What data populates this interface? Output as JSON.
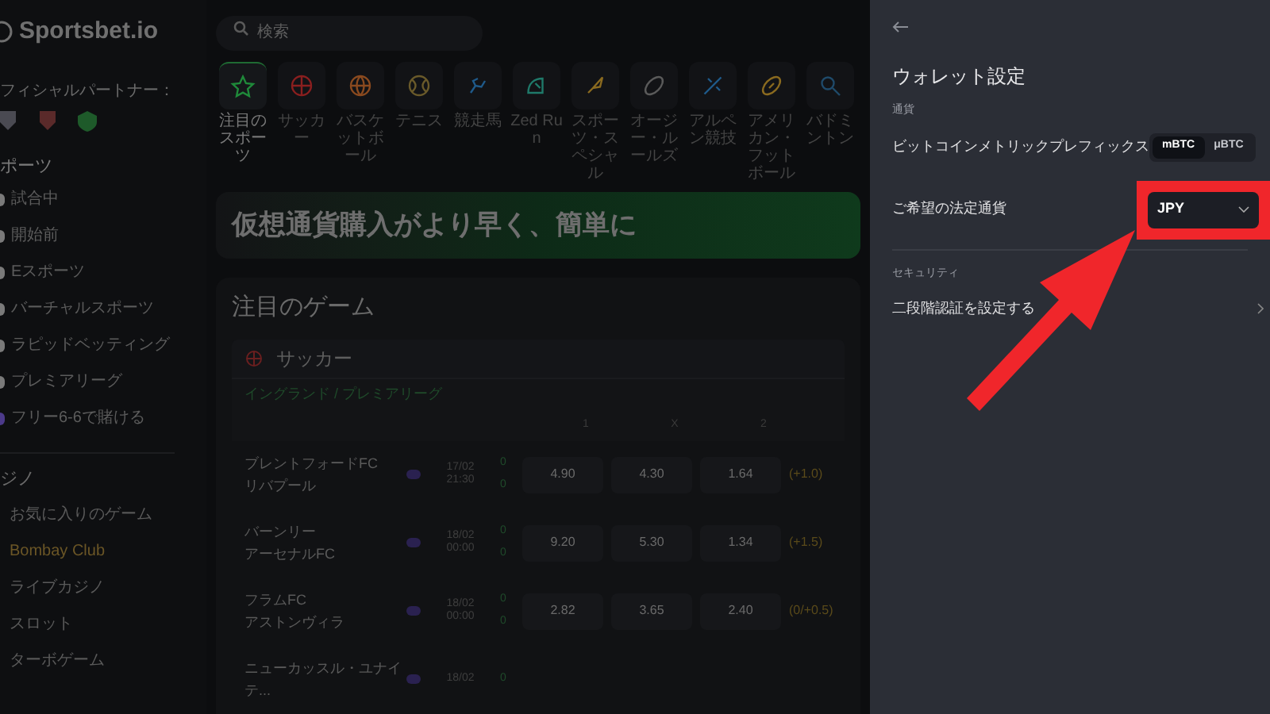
{
  "logo": "Sportsbet.io",
  "search": {
    "placeholder": "検索"
  },
  "sidebar": {
    "partners_label": "フィシャルパートナー：",
    "sports_heading": "ポーツ",
    "sports_items": [
      {
        "label": "試合中",
        "color": "#7a7a7a"
      },
      {
        "label": "開始前",
        "color": "#7a7a7a"
      },
      {
        "label": "Eスポーツ",
        "color": "#7a7a7a"
      },
      {
        "label": "バーチャルスポーツ",
        "color": "#7a7a7a"
      },
      {
        "label": "ラピッドベッティング",
        "color": "#7a7a7a"
      },
      {
        "label": "プレミアリーグ",
        "color": "#7a7a7a"
      },
      {
        "label": "フリー6-6で賭ける",
        "color": "#4c3a8a"
      }
    ],
    "casino_heading": "ジノ",
    "casino_items": [
      {
        "label": "お気に入りのゲーム",
        "color": "#5a5a5a"
      },
      {
        "label": "Bombay Club",
        "color": "#6b5626"
      },
      {
        "label": "ライブカジノ",
        "color": "#5a5a5a"
      },
      {
        "label": "スロット",
        "color": "#5a5a5a"
      },
      {
        "label": "ターボゲーム",
        "color": "#5a5a5a"
      }
    ]
  },
  "categories": [
    {
      "label": "注目のスポーツ",
      "selected": true,
      "color": "#1f8a3a"
    },
    {
      "label": "サッカー",
      "selected": false,
      "color": "#8a1f1f"
    },
    {
      "label": "バスケットボール",
      "selected": false,
      "color": "#8a4a1f"
    },
    {
      "label": "テニス",
      "selected": false,
      "color": "#6a5a2a"
    },
    {
      "label": "競走馬",
      "selected": false,
      "color": "#1f5a8a"
    },
    {
      "label": "Zed Run",
      "selected": false,
      "color": "#1f7a6a"
    },
    {
      "label": "スポーツ・スペシャル",
      "selected": false,
      "color": "#8a6a1f"
    },
    {
      "label": "オージー・ルールズ",
      "selected": false,
      "color": "#5a5a5a"
    },
    {
      "label": "アルペン競技",
      "selected": false,
      "color": "#1f5a8a"
    },
    {
      "label": "アメリカン・フットボール",
      "selected": false,
      "color": "#8a6a1f"
    },
    {
      "label": "バドミントン",
      "selected": false,
      "color": "#1f4a6a"
    }
  ],
  "banner": {
    "text": "仮想通貨購入がより早く、簡単に"
  },
  "featured": {
    "title": "注目のゲーム",
    "sport": "サッカー",
    "league": "イングランド / プレミアリーグ",
    "columns": [
      "1",
      "X",
      "2"
    ],
    "matches": [
      {
        "home": "ブレントフォードFC",
        "away": "リバプール",
        "date": "17/02",
        "time": "21:30",
        "score_home": "0",
        "score_away": "0",
        "odds": [
          "4.90",
          "4.30",
          "1.64"
        ],
        "handicap": "(+1.0)"
      },
      {
        "home": "バーンリー",
        "away": "アーセナルFC",
        "date": "18/02",
        "time": "00:00",
        "score_home": "0",
        "score_away": "0",
        "odds": [
          "9.20",
          "5.30",
          "1.34"
        ],
        "handicap": "(+1.5)"
      },
      {
        "home": "フラムFC",
        "away": "アストンヴィラ",
        "date": "18/02",
        "time": "00:00",
        "score_home": "0",
        "score_away": "0",
        "odds": [
          "2.82",
          "3.65",
          "2.40"
        ],
        "handicap": "(0/+0.5)"
      },
      {
        "home": "ニューカッスル・ユナイテ...",
        "date": "18/02",
        "score_home": "0"
      }
    ]
  },
  "panel": {
    "title": "ウォレット設定",
    "currency_heading": "通貨",
    "prefix_label": "ビットコインメトリックプレフィックス",
    "prefix_options": [
      {
        "label": "mBTC",
        "selected": true
      },
      {
        "label": "μBTC",
        "selected": false
      }
    ],
    "fiat_label": "ご希望の法定通貨",
    "fiat_value": "JPY",
    "security_heading": "セキュリティ",
    "twofa_label": "二段階認証を設定する"
  },
  "annotation": {
    "highlight": true
  }
}
